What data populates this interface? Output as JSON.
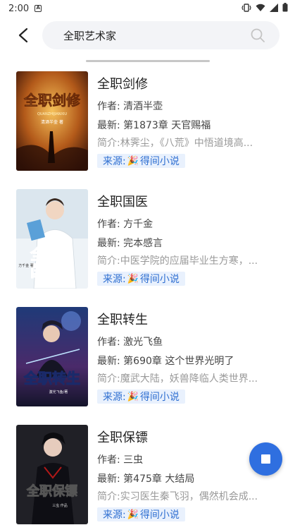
{
  "status_bar": {
    "time": "2:00"
  },
  "search": {
    "query": "全职艺术家"
  },
  "results": [
    {
      "title": "全职剑修",
      "author_label": "作者: 清酒半壶",
      "latest_label": "最新: 第1873章 天官赐福",
      "intro_label": "简介:林霁尘，《八荒》中悟道境高...",
      "source_prefix": "来源:",
      "source_name": "得间小说",
      "cover_text": "全职剑修",
      "cover_sub": "QUANZHIJIANXIU",
      "cover_author": "清酒半壶 著"
    },
    {
      "title": "全职国医",
      "author_label": "作者: 方千金",
      "latest_label": "最新: 完本感言",
      "intro_label": "简介:中医学院的应届毕业生方寒，...",
      "source_prefix": "来源:",
      "source_name": "得间小说",
      "cover_text": "全职国医",
      "cover_author": "方千金 著"
    },
    {
      "title": "全职转生",
      "author_label": "作者: 激光飞鱼",
      "latest_label": "最新: 第690章 这个世界光明了",
      "intro_label": "简介:魔武大陆，妖兽降临人类世界...",
      "source_prefix": "来源:",
      "source_name": "得间小说",
      "cover_text": "全职转生",
      "cover_author": "激光飞鱼/著"
    },
    {
      "title": "全职保镖",
      "author_label": "作者: 三虫",
      "latest_label": "最新: 第475章 大结局",
      "intro_label": "简介:实习医生秦飞羽，偶然机会成...",
      "source_prefix": "来源:",
      "source_name": "得间小说",
      "cover_text": "全职保镖",
      "cover_author": "三虫 作品"
    }
  ],
  "colors": {
    "accent": "#2f6fe0",
    "source_bg": "#e9f1fd",
    "source_text": "#2f6fd1"
  },
  "icons": {
    "back": "arrow-left-icon",
    "search": "search-icon",
    "stop": "stop-icon",
    "source": "party-popper-icon"
  }
}
